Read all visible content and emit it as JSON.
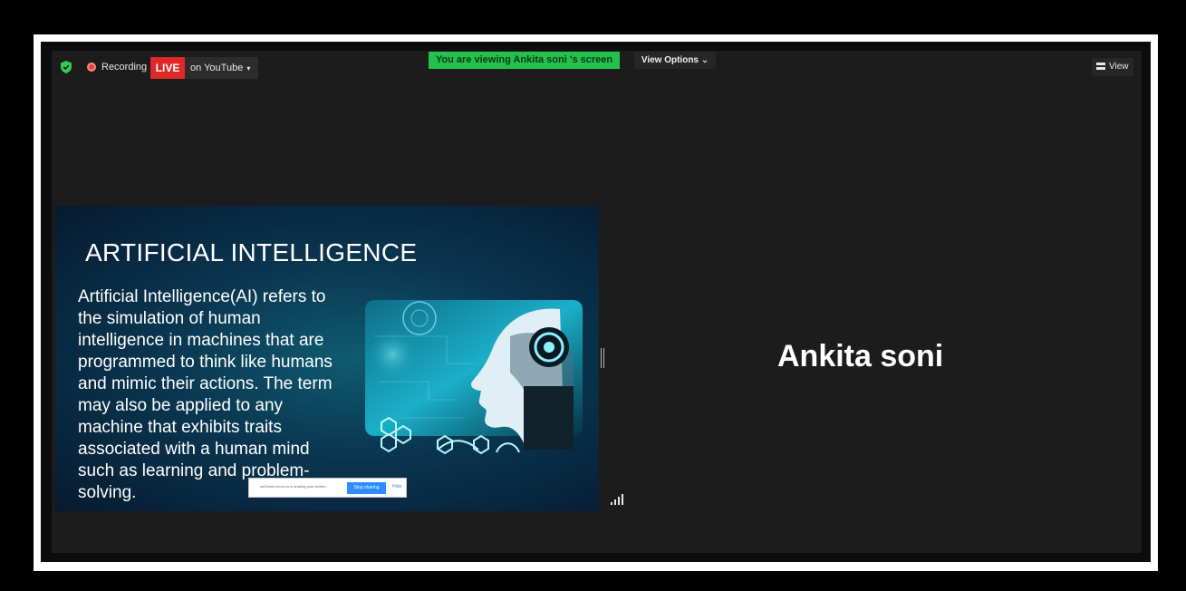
{
  "toolbar": {
    "security_icon": "shield-check-icon",
    "recording_label": "Recording",
    "live_label": "LIVE",
    "youtube_label": "on YouTube",
    "youtube_caret": "▾",
    "viewing_banner": "You are viewing Ankita soni 's screen",
    "view_options_label": "View Options ⌄",
    "view_label": "View"
  },
  "slide": {
    "title": "ARTIFICIAL INTELLIGENCE",
    "body": "Artificial Intelligence(AI) refers to the simulation of human intelligence in machines that are programmed to think like humans and mimic their actions. The term may also be applied to any machine that exhibits traits associated with a human mind such as learning and problem-solving.",
    "share_text": "us02web.zoom.us is sharing your screen.",
    "stop_sharing_label": "Stop sharing",
    "hide_label": "Hide"
  },
  "participant": {
    "name": "Ankita soni"
  },
  "colors": {
    "live": "#e02828",
    "viewing_banner": "#25c14d",
    "stop_sharing": "#2d8cff"
  }
}
